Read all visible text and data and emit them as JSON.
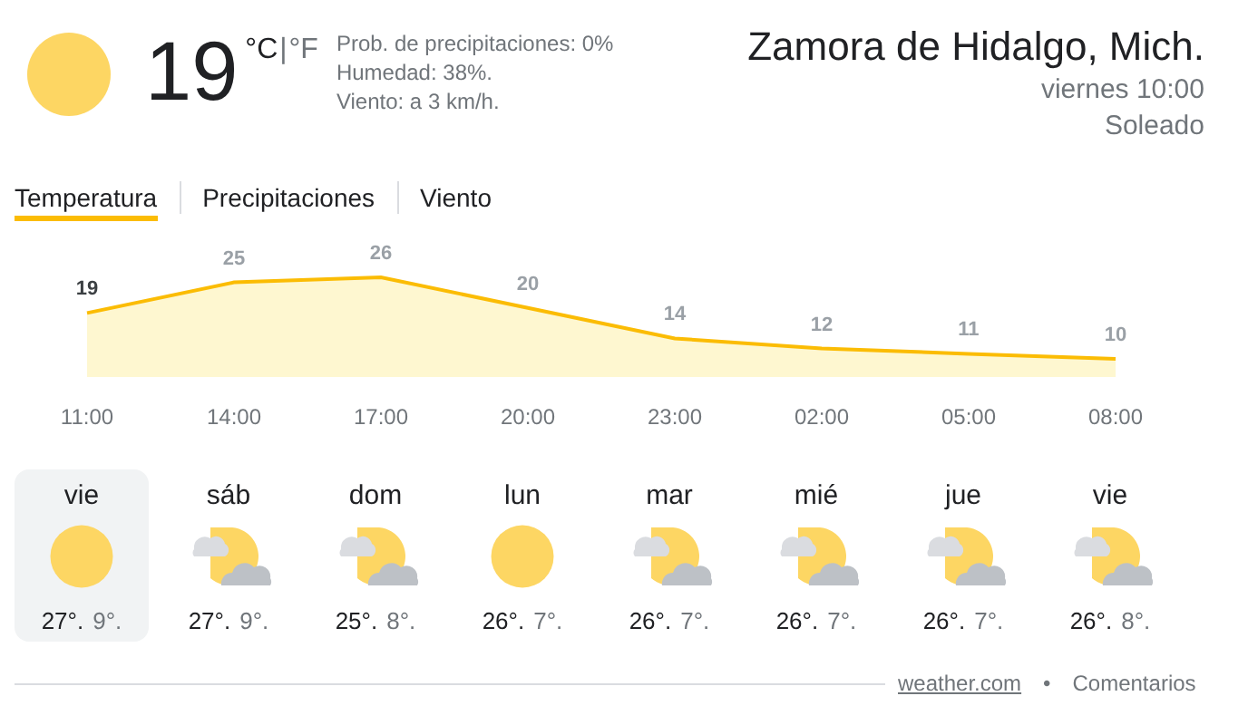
{
  "current": {
    "kind": "sunny",
    "temperature": "19",
    "unit_c": "°C",
    "separator": "|",
    "unit_f": "°F",
    "details": [
      "Prob. de precipitaciones: 0%",
      "Humedad: 38%.",
      "Viento: a 3 km/h."
    ]
  },
  "location": {
    "name": "Zamora de Hidalgo, Mich.",
    "time": "viernes 10:00",
    "condition": "Soleado"
  },
  "tabs": [
    {
      "label": "Temperatura",
      "selected": true
    },
    {
      "label": "Precipitaciones",
      "selected": false
    },
    {
      "label": "Viento",
      "selected": false
    }
  ],
  "chart_data": {
    "type": "area",
    "categories": [
      "11:00",
      "14:00",
      "17:00",
      "20:00",
      "23:00",
      "02:00",
      "05:00",
      "08:00"
    ],
    "series": [
      {
        "color": "#fbbc04",
        "values": [
          19,
          25,
          26,
          20,
          14,
          12,
          11,
          10
        ]
      }
    ],
    "data_labels": true
  },
  "days": [
    {
      "name": "vie",
      "kind": "sunny",
      "high": "27°.",
      "low": "9°.",
      "selected": true
    },
    {
      "name": "sáb",
      "kind": "partly_cloudy",
      "high": "27°.",
      "low": "9°.",
      "selected": false
    },
    {
      "name": "dom",
      "kind": "partly_cloudy",
      "high": "25°.",
      "low": "8°.",
      "selected": false
    },
    {
      "name": "lun",
      "kind": "sunny",
      "high": "26°.",
      "low": "7°.",
      "selected": false
    },
    {
      "name": "mar",
      "kind": "partly_cloudy",
      "high": "26°.",
      "low": "7°.",
      "selected": false
    },
    {
      "name": "mié",
      "kind": "partly_cloudy",
      "high": "26°.",
      "low": "7°.",
      "selected": false
    },
    {
      "name": "jue",
      "kind": "partly_cloudy",
      "high": "26°.",
      "low": "7°.",
      "selected": false
    },
    {
      "name": "vie",
      "kind": "partly_cloudy",
      "high": "26°.",
      "low": "8°.",
      "selected": false
    }
  ],
  "footer": {
    "source": "weather.com",
    "bullet": "•",
    "feedback": "Comentarios"
  }
}
